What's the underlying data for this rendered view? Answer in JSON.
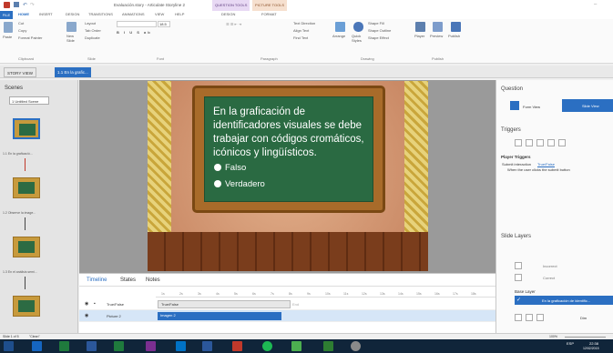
{
  "window": {
    "title": "Evaluación.story - Articulate Storyline 2",
    "context_tab_1": "QUESTION TOOLS",
    "context_tab_2": "PICTURE TOOLS"
  },
  "ribbon_tabs": [
    "FILE",
    "HOME",
    "INSERT",
    "DESIGN",
    "TRANSITIONS",
    "ANIMATIONS",
    "VIEW",
    "HELP",
    "DESIGN",
    "FORMAT"
  ],
  "ribbon": {
    "clipboard": {
      "paste": "Paste",
      "cut": "Cut",
      "copy": "Copy",
      "format_painter": "Format Painter",
      "label": "Clipboard"
    },
    "slide": {
      "new_slide": "New Slide",
      "layout": "Layout",
      "tab_order": "Tab Order",
      "duplicate": "Duplicate",
      "label": "Slide"
    },
    "font": {
      "size": "18.5",
      "label": "Font"
    },
    "paragraph": {
      "text_direction": "Text Direction",
      "align_text": "Align Text",
      "find_text": "Find Text",
      "label": "Paragraph"
    },
    "drawing": {
      "arrange": "Arrange",
      "quick_styles": "Quick Styles",
      "shape_fill": "Shape Fill",
      "shape_outline": "Shape Outline",
      "shape_effect": "Shape Effect",
      "label": "Drawing"
    },
    "publish": {
      "player": "Player",
      "preview": "Preview",
      "publish": "Publish",
      "label": "Publish"
    }
  },
  "doctabs": {
    "story_view": "STORY VIEW",
    "slide_tab": "1.1 En la grafic..."
  },
  "scenes": {
    "title": "Scenes",
    "dropdown": "1 Untitled Scene",
    "thumbs": [
      "1.1 En la graficació...",
      "1.2 Observe la image...",
      "1.3 En el análisis semi..."
    ]
  },
  "slide": {
    "question": "En la graficación de identificadores visuales se debe trabajar con códigos cromáticos, icónicos y lingüísticos.",
    "options": [
      "Falso",
      "Verdadero"
    ]
  },
  "timeline": {
    "tabs": [
      "Timeline",
      "States",
      "Notes"
    ],
    "ruler": [
      "1s",
      "2s",
      "3s",
      "4s",
      "5s",
      "6s",
      "7s",
      "8s",
      "9s",
      "10s",
      "11s",
      "12s",
      "13s",
      "14s",
      "15s",
      "16s",
      "17s",
      "18s"
    ],
    "rows": [
      {
        "name": "True/False",
        "bar": "True/False"
      },
      {
        "name": "Picture 2",
        "bar": "Imagen 2"
      }
    ],
    "end": "End"
  },
  "right": {
    "question": "Question",
    "form_view": "Form View",
    "slide_view": "Slide View",
    "triggers": "Triggers",
    "player_triggers": "Player Triggers",
    "trigger_line1": "Submit interaction",
    "trigger_link": "True/False",
    "trigger_line2": "When the user clicks the submit button",
    "slide_layers": "Slide Layers",
    "layers": [
      "Incorrect",
      "Correct"
    ],
    "base_layer": "Base Layer",
    "base_layer_name": "En la graficación de identific...",
    "dim": "Dim"
  },
  "status": {
    "slide": "Slide 1 of 5",
    "theme": "\"Clean\"",
    "zoom": "100%"
  },
  "taskbar": {
    "time": "22:38",
    "date": "12/02/2015",
    "lang": "ESP"
  },
  "colors": {
    "accent": "#2b6fc2",
    "board": "#2a6a42",
    "taskbar": "#10253a"
  }
}
